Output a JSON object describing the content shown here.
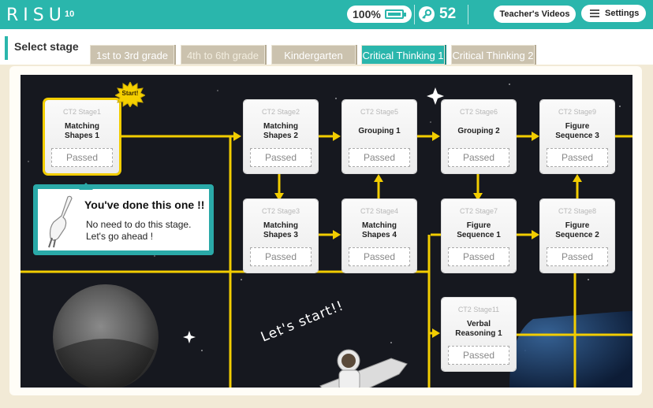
{
  "topbar": {
    "logo": "RISU",
    "logo_number": "10",
    "battery_percent": "100%",
    "battery_level": 1.0,
    "points": "52",
    "teacher_videos": "Teacher's Videos",
    "settings": "Settings"
  },
  "header": {
    "title": "Select stage",
    "tabs": [
      {
        "label": "1st to 3rd grade",
        "active": false
      },
      {
        "label": "4th to 6th grade",
        "active": false
      },
      {
        "label": "Kindergarten",
        "active": false
      },
      {
        "label": "Critical Thinking 1",
        "active": true
      },
      {
        "label": "Critical Thinking 2",
        "active": false
      }
    ]
  },
  "start_badge": "Start!",
  "stages": [
    {
      "code": "CT2 Stage1",
      "name_line1": "Matching",
      "name_line2": "Shapes 1",
      "status": "Passed"
    },
    {
      "code": "CT2 Stage2",
      "name_line1": "Matching",
      "name_line2": "Shapes 2",
      "status": "Passed"
    },
    {
      "code": "CT2 Stage5",
      "name_line1": "Grouping 1",
      "name_line2": "",
      "status": "Passed"
    },
    {
      "code": "CT2 Stage6",
      "name_line1": "Grouping 2",
      "name_line2": "",
      "status": "Passed"
    },
    {
      "code": "CT2 Stage9",
      "name_line1": "Figure",
      "name_line2": "Sequence 3",
      "status": "Passed"
    },
    {
      "code": "CT2 Stage3",
      "name_line1": "Matching",
      "name_line2": "Shapes 3",
      "status": "Passed"
    },
    {
      "code": "CT2 Stage4",
      "name_line1": "Matching",
      "name_line2": "Shapes 4",
      "status": "Passed"
    },
    {
      "code": "CT2 Stage7",
      "name_line1": "Figure",
      "name_line2": "Sequence 1",
      "status": "Passed"
    },
    {
      "code": "CT2 Stage8",
      "name_line1": "Figure",
      "name_line2": "Sequence 2",
      "status": "Passed"
    },
    {
      "code": "CT2 Stage11",
      "name_line1": "Verbal",
      "name_line2": "Reasoning 1",
      "status": "Passed"
    }
  ],
  "tooltip": {
    "title": "You've done this one !!",
    "line1": "No need to do this stage.",
    "line2": "Let's go ahead !"
  },
  "lets_start": "Let's start!!",
  "colors": {
    "teal": "#2ab6ac",
    "path_yellow": "#f2cd00",
    "space_bg": "#16181f"
  }
}
